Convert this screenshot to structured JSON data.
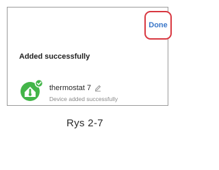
{
  "toolbar": {
    "done_label": "Done"
  },
  "result": {
    "headline": "Added successfully"
  },
  "device": {
    "name": "thermostat 7",
    "status": "Device added successfully",
    "icon": "thermostat-icon",
    "badge_icon": "checkmark-icon",
    "edit_icon": "pencil-icon"
  },
  "caption": "Rys 2-7",
  "colors": {
    "accent": "#3a77c9",
    "highlight": "#d8363f",
    "success": "#43b549"
  }
}
